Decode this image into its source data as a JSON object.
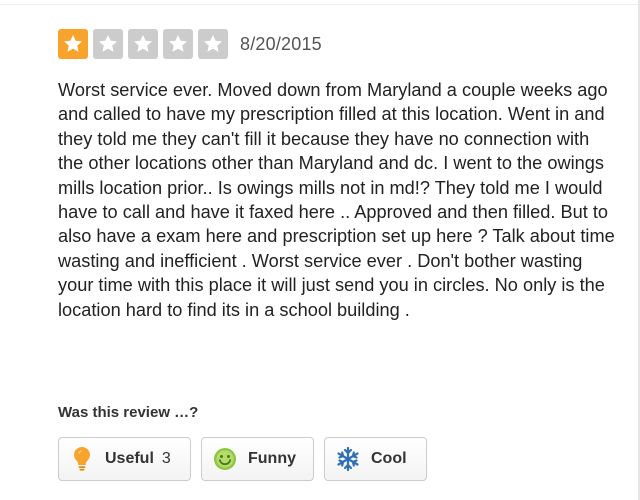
{
  "review": {
    "rating": 1,
    "max_rating": 5,
    "date": "8/20/2015",
    "text": "Worst service ever. Moved down from Maryland a couple weeks ago and called to have my prescription filled at this location. Went in and they told me they can't fill it because they have no connection with the other locations other than Maryland and dc. I went to the owings mills location prior.. Is owings mills not in md!? They told me I would have to call and have it faxed here .. Approved and then filled. But to also have a exam here and prescription set up here ? Talk about time wasting and inefficient . Worst service ever . Don't bother wasting your time with this place it will just send you in circles. No only is the location hard to find its in a school building ."
  },
  "feedback": {
    "question": "Was this review …?",
    "useful": {
      "label": "Useful",
      "count": "3",
      "icon": "lightbulb-icon"
    },
    "funny": {
      "label": "Funny",
      "icon": "smiley-icon"
    },
    "cool": {
      "label": "Cool",
      "icon": "snowflake-icon"
    }
  },
  "colors": {
    "star_filled": "#f8a32b",
    "star_empty": "#cccccc",
    "useful_icon": "#f8a32b",
    "funny_icon": "#8ec63f",
    "cool_icon": "#2f6fb5"
  }
}
